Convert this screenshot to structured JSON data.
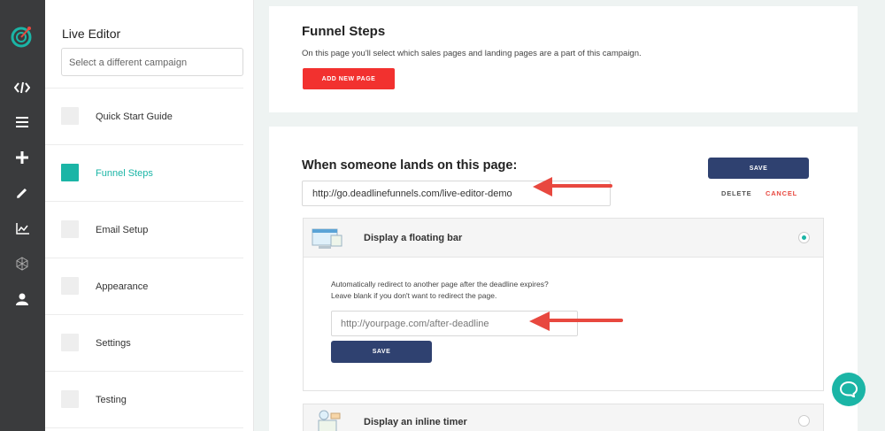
{
  "rail": {
    "icons": [
      "logo-icon",
      "code-icon",
      "menu-icon",
      "plus-icon",
      "pencil-icon",
      "chart-icon",
      "hexagon-icon",
      "user-icon"
    ]
  },
  "sidebar": {
    "title": "Live Editor",
    "campaign_select": "Select a different campaign",
    "items": [
      {
        "label": "Quick Start Guide",
        "active": false
      },
      {
        "label": "Funnel Steps",
        "active": true
      },
      {
        "label": "Email Setup",
        "active": false
      },
      {
        "label": "Appearance",
        "active": false
      },
      {
        "label": "Settings",
        "active": false
      },
      {
        "label": "Testing",
        "active": false
      }
    ]
  },
  "funnel": {
    "title": "Funnel Steps",
    "description": "On this page you'll select which sales pages and landing pages are a part of this campaign.",
    "add_button": "ADD NEW PAGE"
  },
  "page_editor": {
    "heading": "When someone lands on this page:",
    "url_value": "http://go.deadlinefunnels.com/live-editor-demo",
    "save_label": "SAVE",
    "delete_label": "DELETE",
    "cancel_label": "CANCEL",
    "options": [
      {
        "label": "Display a floating bar",
        "selected": true
      },
      {
        "label": "Display an inline timer",
        "selected": false
      }
    ],
    "redirect_help_1": "Automatically redirect to another page after the deadline expires?",
    "redirect_help_2": "Leave blank if you don't want to redirect the page.",
    "redirect_placeholder": "http://yourpage.com/after-deadline",
    "redirect_save_label": "SAVE"
  },
  "colors": {
    "accent": "#1bb5a6",
    "danger": "#f2312f",
    "navy": "#2f4170",
    "rail": "#3a3b3d",
    "annotation_arrow": "#e8483f"
  }
}
